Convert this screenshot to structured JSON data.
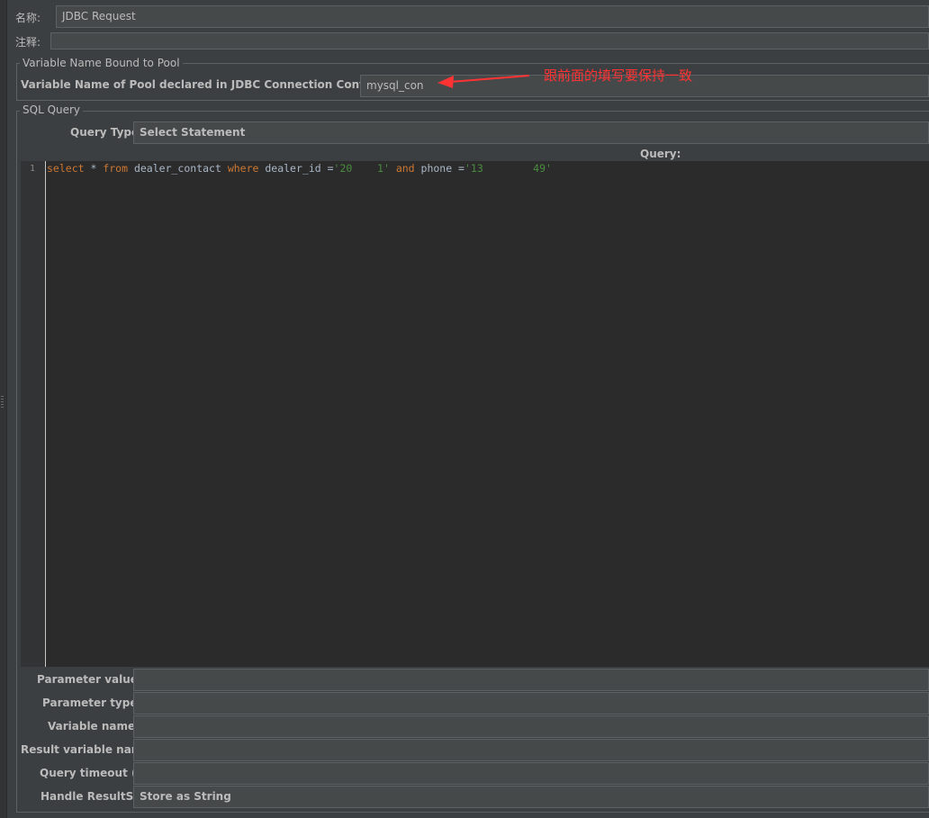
{
  "name_row": {
    "label": "名称:",
    "value": "JDBC Request"
  },
  "comment_row": {
    "label": "注释:",
    "value": ""
  },
  "pool_group": {
    "legend": "Variable Name Bound to Pool",
    "field_label": "Variable Name of Pool declared in JDBC Connection Configuration:",
    "field_value": "mysql_con"
  },
  "annotation": {
    "text": "跟前面的填写要保持一致",
    "color": "#ff3333"
  },
  "sql_group": {
    "legend": "SQL Query",
    "query_type_label": "Query Type:",
    "query_type_value": "Select Statement",
    "query_header": "Query:",
    "line_number": "1",
    "code": {
      "t1": "select",
      "t2": " * ",
      "t3": "from",
      "t4": " dealer_contact ",
      "t5": "where",
      "t6": " dealer_id =",
      "t7": "'20",
      "t8": "    ",
      "t9": "1'",
      "t10": " ",
      "t11": "and",
      "t12": " phone =",
      "t13": "'13",
      "t14": "        ",
      "t15": "49'"
    }
  },
  "params": {
    "parameter_values_label": "Parameter values:",
    "parameter_values": "",
    "parameter_types_label": "Parameter types:",
    "parameter_types": "",
    "variable_names_label": "Variable names:",
    "variable_names": "",
    "result_variable_label": "Result variable name:",
    "result_variable": "",
    "query_timeout_label": "Query timeout (s):",
    "query_timeout": "",
    "handle_resultset_label": "Handle ResultSet:",
    "handle_resultset": "Store as String"
  },
  "colors": {
    "background": "#3c3f41",
    "field": "#45494a",
    "editor": "#2b2b2b",
    "keyword": "#cc7832",
    "string": "#4a8c3f"
  }
}
